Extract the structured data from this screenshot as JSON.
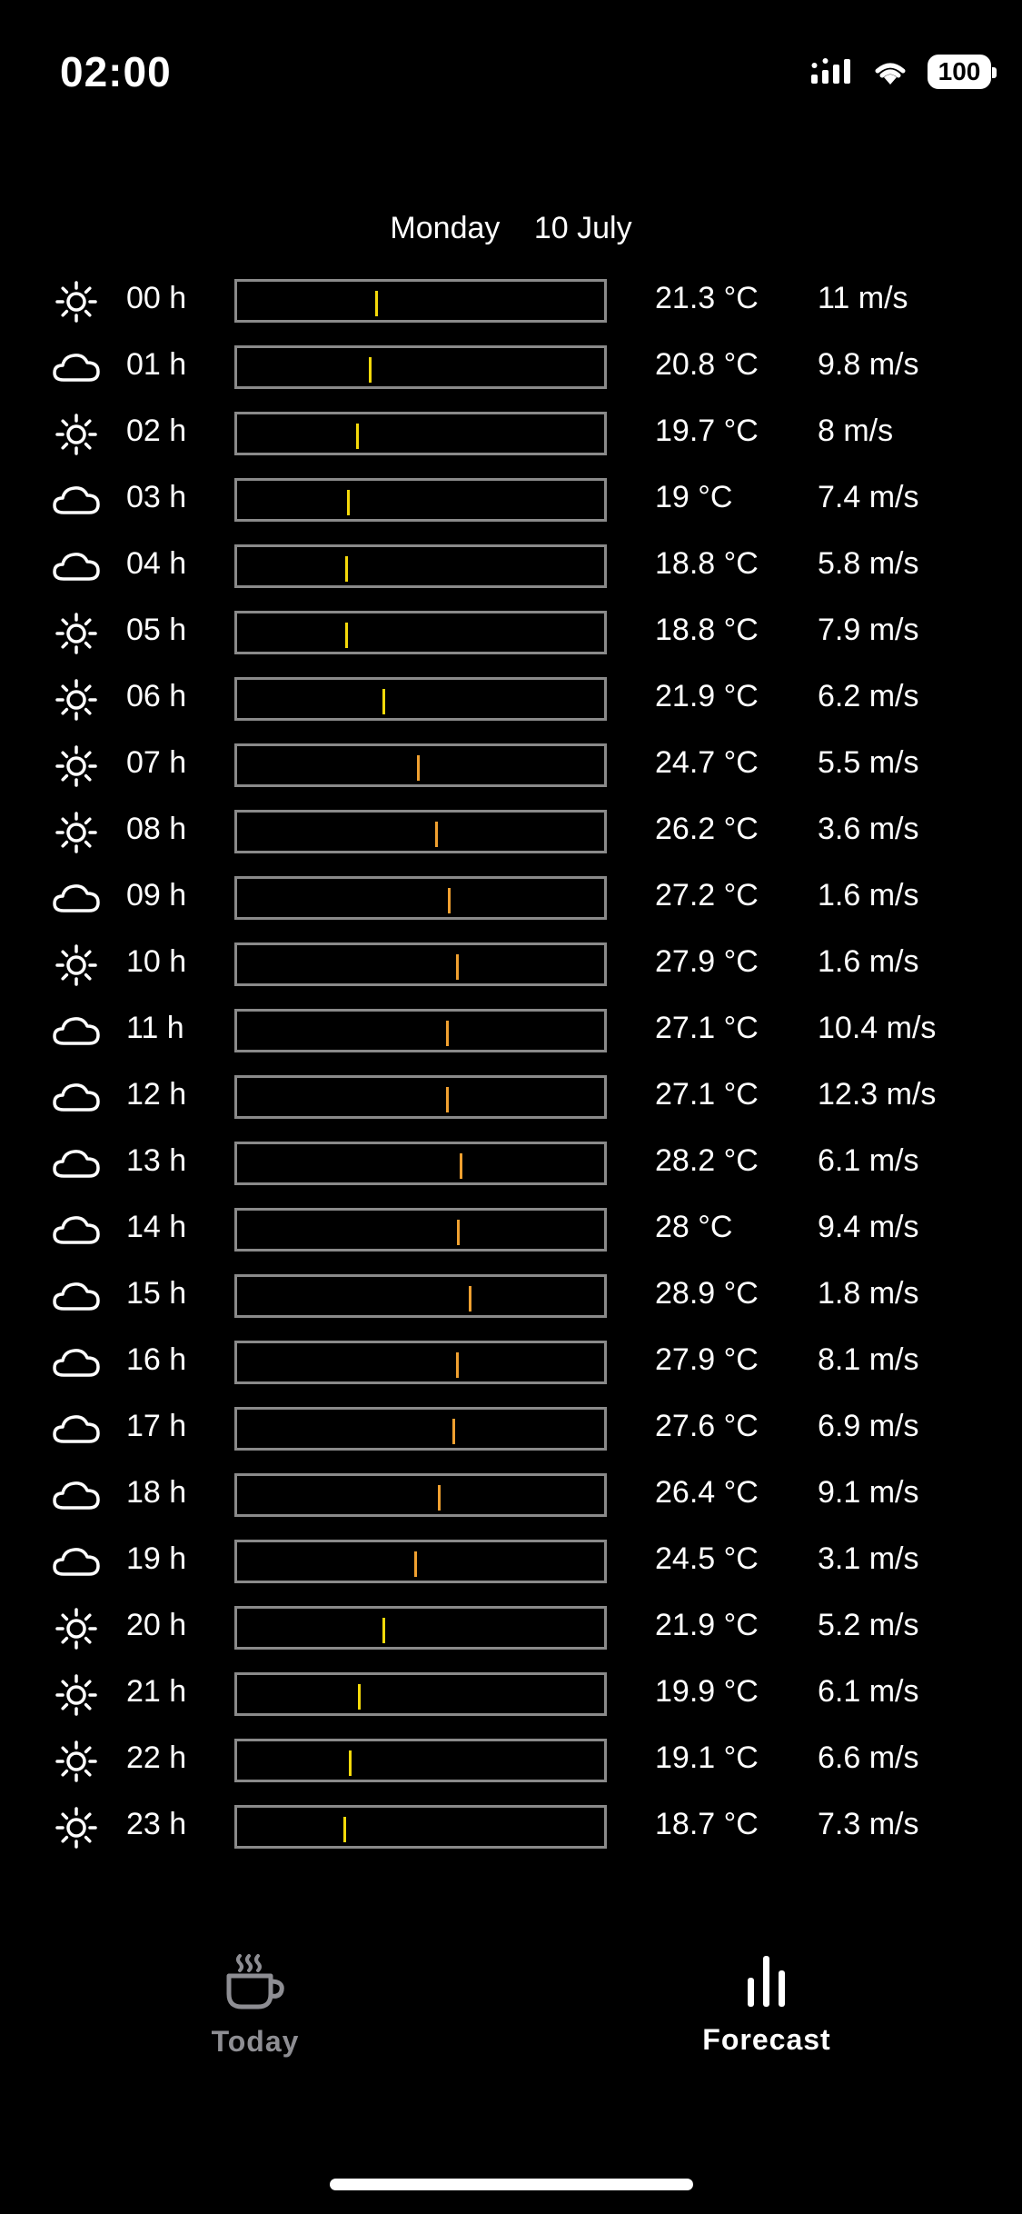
{
  "status": {
    "time": "02:00",
    "battery": "100"
  },
  "date": {
    "weekday": "Monday",
    "day": "10 July"
  },
  "hours": [
    {
      "hour": "00 h",
      "icon": "sun-icon",
      "temp": "21.3 °C",
      "wind": "11 m/s",
      "value": 21.3
    },
    {
      "hour": "01 h",
      "icon": "cloud-icon",
      "temp": "20.8 °C",
      "wind": "9.8 m/s",
      "value": 20.8
    },
    {
      "hour": "02 h",
      "icon": "sun-icon",
      "temp": "19.7 °C",
      "wind": "8 m/s",
      "value": 19.7
    },
    {
      "hour": "03 h",
      "icon": "cloud-icon",
      "temp": "19 °C",
      "wind": "7.4 m/s",
      "value": 19
    },
    {
      "hour": "04 h",
      "icon": "cloud-icon",
      "temp": "18.8 °C",
      "wind": "5.8 m/s",
      "value": 18.8
    },
    {
      "hour": "05 h",
      "icon": "sun-icon",
      "temp": "18.8 °C",
      "wind": "7.9 m/s",
      "value": 18.8
    },
    {
      "hour": "06 h",
      "icon": "sun-icon",
      "temp": "21.9 °C",
      "wind": "6.2 m/s",
      "value": 21.9
    },
    {
      "hour": "07 h",
      "icon": "sun-icon",
      "temp": "24.7 °C",
      "wind": "5.5 m/s",
      "value": 24.7
    },
    {
      "hour": "08 h",
      "icon": "sun-icon",
      "temp": "26.2 °C",
      "wind": "3.6 m/s",
      "value": 26.2
    },
    {
      "hour": "09 h",
      "icon": "cloud-icon",
      "temp": "27.2 °C",
      "wind": "1.6 m/s",
      "value": 27.2
    },
    {
      "hour": "10 h",
      "icon": "sun-icon",
      "temp": "27.9 °C",
      "wind": "1.6 m/s",
      "value": 27.9
    },
    {
      "hour": "11 h",
      "icon": "cloud-icon",
      "temp": "27.1 °C",
      "wind": "10.4 m/s",
      "value": 27.1
    },
    {
      "hour": "12 h",
      "icon": "cloud-icon",
      "temp": "27.1 °C",
      "wind": "12.3 m/s",
      "value": 27.1
    },
    {
      "hour": "13 h",
      "icon": "cloud-icon",
      "temp": "28.2 °C",
      "wind": "6.1 m/s",
      "value": 28.2
    },
    {
      "hour": "14 h",
      "icon": "cloud-icon",
      "temp": "28 °C",
      "wind": "9.4 m/s",
      "value": 28
    },
    {
      "hour": "15 h",
      "icon": "cloud-icon",
      "temp": "28.9 °C",
      "wind": "1.8 m/s",
      "value": 28.9
    },
    {
      "hour": "16 h",
      "icon": "cloud-icon",
      "temp": "27.9 °C",
      "wind": "8.1 m/s",
      "value": 27.9
    },
    {
      "hour": "17 h",
      "icon": "cloud-icon",
      "temp": "27.6 °C",
      "wind": "6.9 m/s",
      "value": 27.6
    },
    {
      "hour": "18 h",
      "icon": "cloud-icon",
      "temp": "26.4 °C",
      "wind": "9.1 m/s",
      "value": 26.4
    },
    {
      "hour": "19 h",
      "icon": "cloud-icon",
      "temp": "24.5 °C",
      "wind": "3.1 m/s",
      "value": 24.5
    },
    {
      "hour": "20 h",
      "icon": "sun-icon",
      "temp": "21.9 °C",
      "wind": "5.2 m/s",
      "value": 21.9
    },
    {
      "hour": "21 h",
      "icon": "sun-icon",
      "temp": "19.9 °C",
      "wind": "6.1 m/s",
      "value": 19.9
    },
    {
      "hour": "22 h",
      "icon": "sun-icon",
      "temp": "19.1 °C",
      "wind": "6.6 m/s",
      "value": 19.1
    },
    {
      "hour": "23 h",
      "icon": "sun-icon",
      "temp": "18.7 °C",
      "wind": "7.3 m/s",
      "value": 18.7
    }
  ],
  "colors": {
    "warm_marker": "#f0a030",
    "mild_marker": "#f5d90a",
    "bar_border": "#8a8a8a",
    "inactive_tab": "#8e8e93"
  },
  "tabs": {
    "today": "Today",
    "forecast": "Forecast",
    "active": "forecast"
  }
}
